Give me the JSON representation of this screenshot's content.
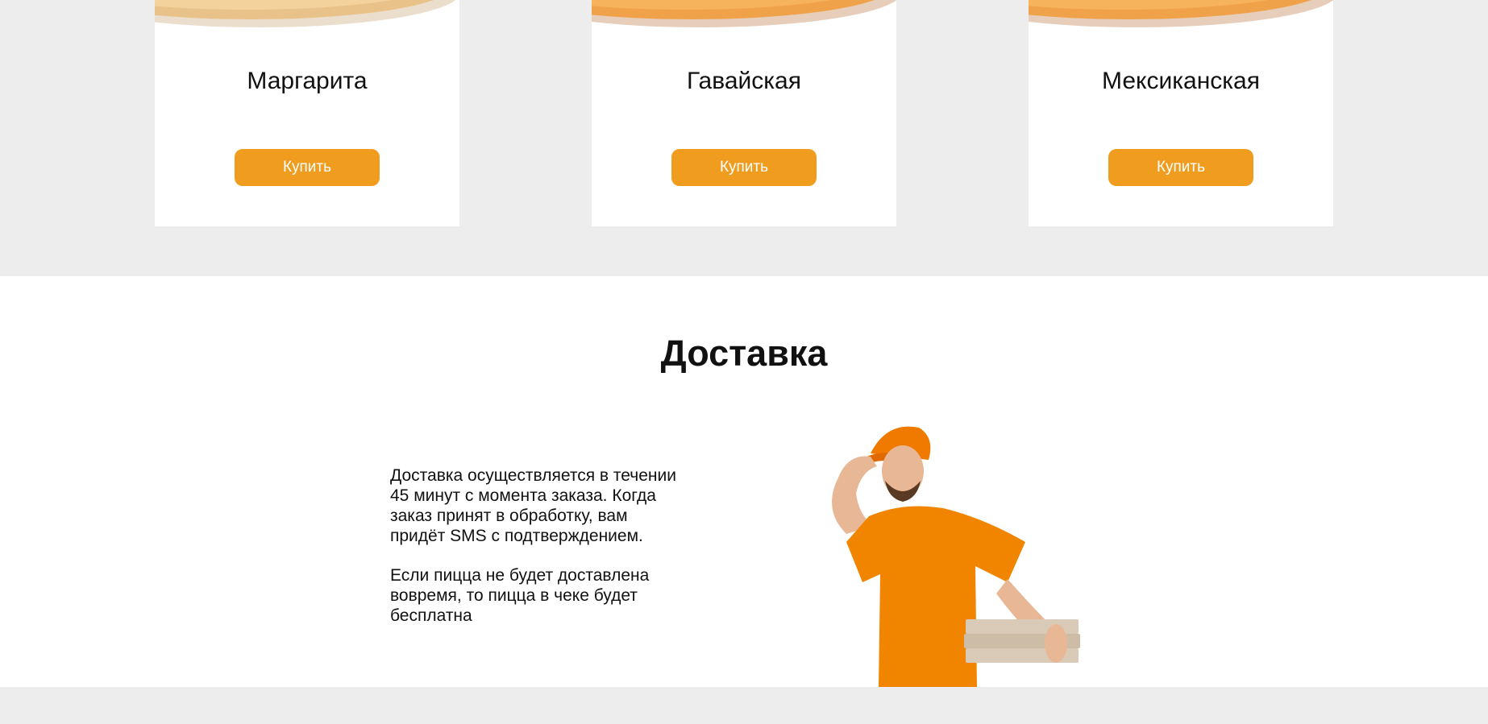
{
  "products": [
    {
      "name": "Маргарита",
      "buy_label": "Купить"
    },
    {
      "name": "Гавайская",
      "buy_label": "Купить"
    },
    {
      "name": "Мексиканская",
      "buy_label": "Купить"
    }
  ],
  "delivery": {
    "title": "Доставка",
    "paragraphs": [
      "Доставка осуществляется в течении 45 минут с момента заказа. Когда заказ принят в обработку, вам придёт SMS с подтверждением.",
      "Если пицца не будет доставлена вовремя, то пицца в чеке будет бесплатна"
    ]
  },
  "colors": {
    "accent": "#f09d1f",
    "page_background": "#ededed",
    "card_background": "#ffffff",
    "courier_shirt": "#f28500"
  },
  "images": {
    "pizza": "pizza-photo",
    "courier": "delivery-courier-photo"
  }
}
